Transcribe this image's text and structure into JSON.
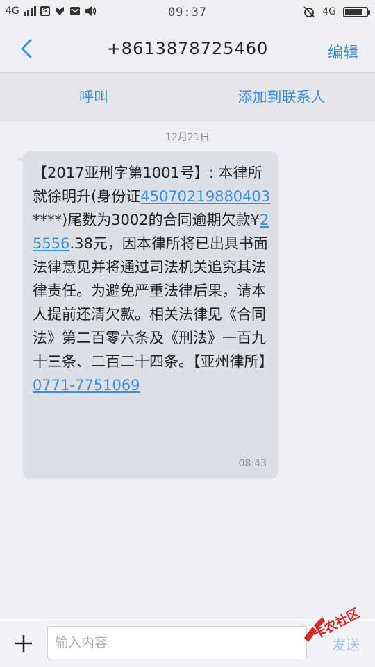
{
  "status_bar": {
    "network_left": "4G",
    "time": "09:37",
    "network_right": "4G",
    "battery_level": 0.85
  },
  "header": {
    "title": "+8613878725460",
    "edit_label": "编辑"
  },
  "actions": {
    "call_label": "呼叫",
    "add_contact_label": "添加到联系人"
  },
  "conversation": {
    "date": "12月21日",
    "message": {
      "part1": "【2017亚刑字第1001号】: 本律所就徐明升(身份证",
      "link_id": "45070219880403",
      "part2": "****)尾数为3002的合同逾期欠款¥",
      "link_amount": "25556",
      "part3": ".38元，因本律所将已出具书面法律意见并将通过司法机关追究其法律责任。为避免严重法律后果，请本人提前还清欠款。相关法律见《合同法》第二百零六条及《刑法》一百九十三条、二百二十四条。【亚州律所】",
      "link_phone": "0771-7751069",
      "time": "08:43"
    }
  },
  "composer": {
    "placeholder": "输入内容",
    "send_label": "发送"
  },
  "watermark": {
    "text": "卡农社区"
  },
  "colors": {
    "accent": "#3a8ee0",
    "bubble": "#dcdfe3",
    "background": "#efeff1"
  }
}
